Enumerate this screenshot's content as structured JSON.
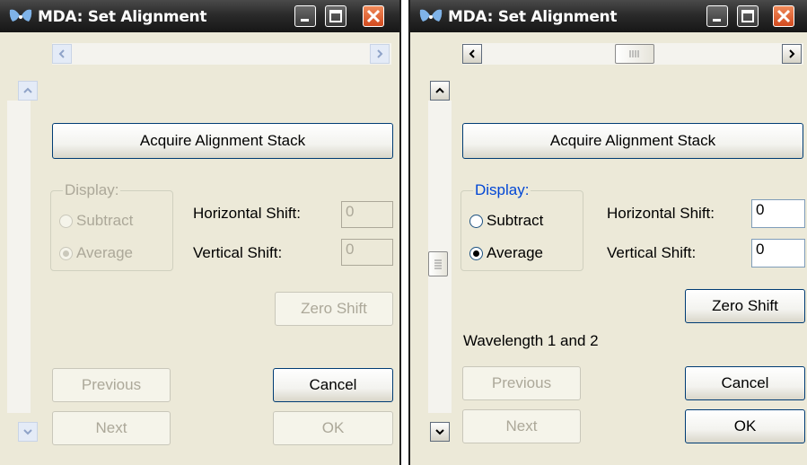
{
  "left_window": {
    "title": "MDA: Set Alignment",
    "state": "disabled",
    "acquire_label": "Acquire Alignment Stack",
    "display_legend": "Display:",
    "radio_subtract": "Subtract",
    "radio_average": "Average",
    "selected_radio": "Average",
    "horizontal_label": "Horizontal Shift:",
    "horizontal_value": "0",
    "vertical_label": "Vertical Shift:",
    "vertical_value": "0",
    "zero_shift_label": "Zero Shift",
    "previous_label": "Previous",
    "next_label": "Next",
    "cancel_label": "Cancel",
    "ok_label": "OK"
  },
  "right_window": {
    "title": "MDA: Set Alignment",
    "state": "enabled",
    "acquire_label": "Acquire Alignment Stack",
    "display_legend": "Display:",
    "radio_subtract": "Subtract",
    "radio_average": "Average",
    "selected_radio": "Average",
    "horizontal_label": "Horizontal Shift:",
    "horizontal_value": "0",
    "vertical_label": "Vertical Shift:",
    "vertical_value": "0",
    "zero_shift_label": "Zero Shift",
    "wavelength_label": "Wavelength 1 and 2",
    "previous_label": "Previous",
    "next_label": "Next",
    "cancel_label": "Cancel",
    "ok_label": "OK"
  },
  "icons": [
    "app-logo-icon",
    "minimize-icon",
    "maximize-icon",
    "close-icon",
    "arrow-left-icon",
    "arrow-right-icon",
    "arrow-up-icon",
    "arrow-down-icon",
    "scroll-thumb-grip-icon"
  ],
  "colors": {
    "titlebar": "#2b2b2b",
    "close_button": "#d24a1e",
    "window_face": "#ece9d8",
    "legend_text": "#0046d5",
    "disabled_text": "#aca899"
  }
}
